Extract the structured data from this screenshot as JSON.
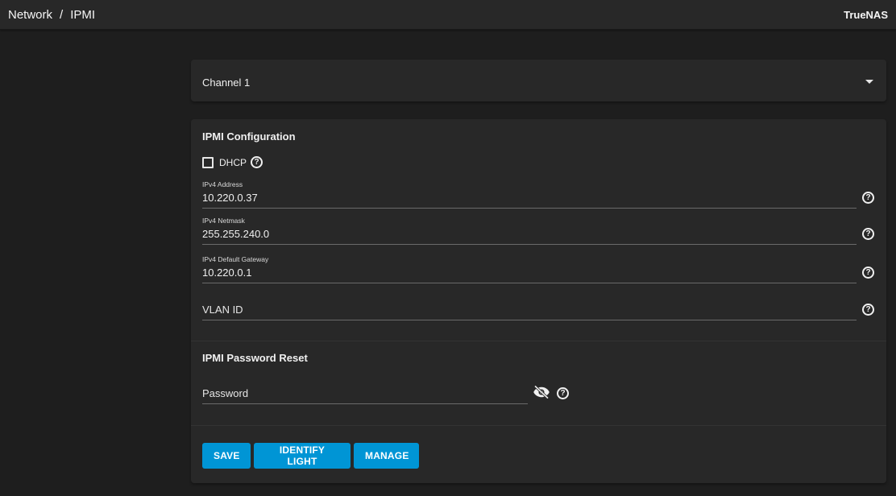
{
  "topbar": {
    "breadcrumb": [
      "Network",
      "IPMI"
    ],
    "separator": "/",
    "brand": "TrueNAS"
  },
  "channel": {
    "selected": "Channel 1"
  },
  "config": {
    "title": "IPMI Configuration",
    "dhcp": {
      "label": "DHCP",
      "checked": false
    },
    "fields": [
      {
        "label": "IPv4 Address",
        "value": "10.220.0.37"
      },
      {
        "label": "IPv4 Netmask",
        "value": "255.255.240.0"
      },
      {
        "label": "IPv4 Default Gateway",
        "value": "10.220.0.1"
      },
      {
        "label": "",
        "value": "",
        "placeholder": "VLAN ID"
      }
    ]
  },
  "password_reset": {
    "title": "IPMI Password Reset",
    "placeholder": "Password",
    "value": ""
  },
  "buttons": {
    "save": "SAVE",
    "identify_light": "IDENTIFY LIGHT",
    "manage": "MANAGE"
  },
  "icons": {
    "help": "?",
    "visibility": "eye-off",
    "dropdown": "caret-down"
  },
  "colors": {
    "accent": "#0095d5",
    "background": "#1e1e1e",
    "card": "#282828"
  }
}
